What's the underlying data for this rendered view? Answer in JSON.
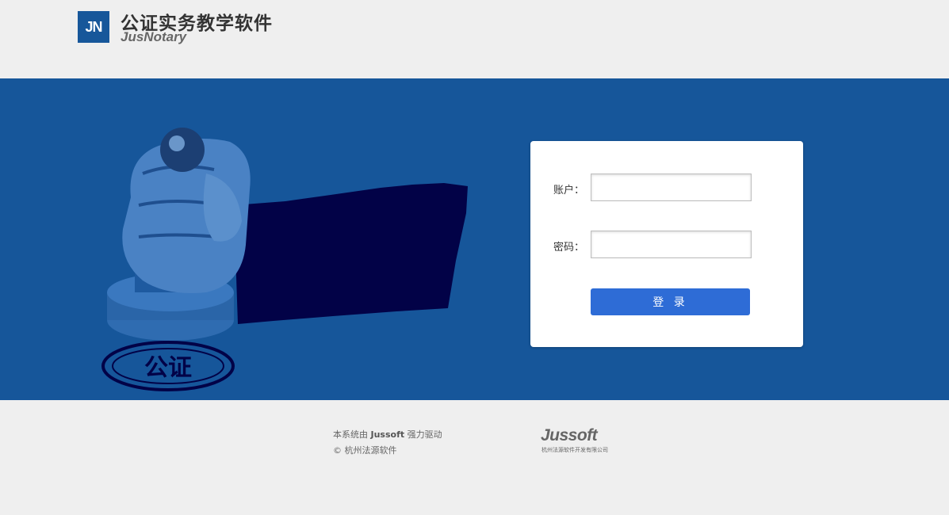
{
  "header": {
    "logo_mark": "JN",
    "title": "公证实务教学软件",
    "subtitle": "JusNotary"
  },
  "banner": {
    "background_color": "#16569a",
    "illustration_icon": "notary-stamp-hand-icon",
    "stamp_text": "公证"
  },
  "login": {
    "account_label": "账户：",
    "password_label": "密码：",
    "account_value": "",
    "password_value": "",
    "submit_label": "登 录",
    "accent_color": "#2e6cd6"
  },
  "footer": {
    "powered_prefix": "本系统由",
    "powered_brand": "Jussoft",
    "powered_suffix": "强力驱动",
    "copyright": "© 杭州法源软件",
    "brand_logo": "Jussoft",
    "brand_company": "杭州法源软件开发有限公司"
  }
}
